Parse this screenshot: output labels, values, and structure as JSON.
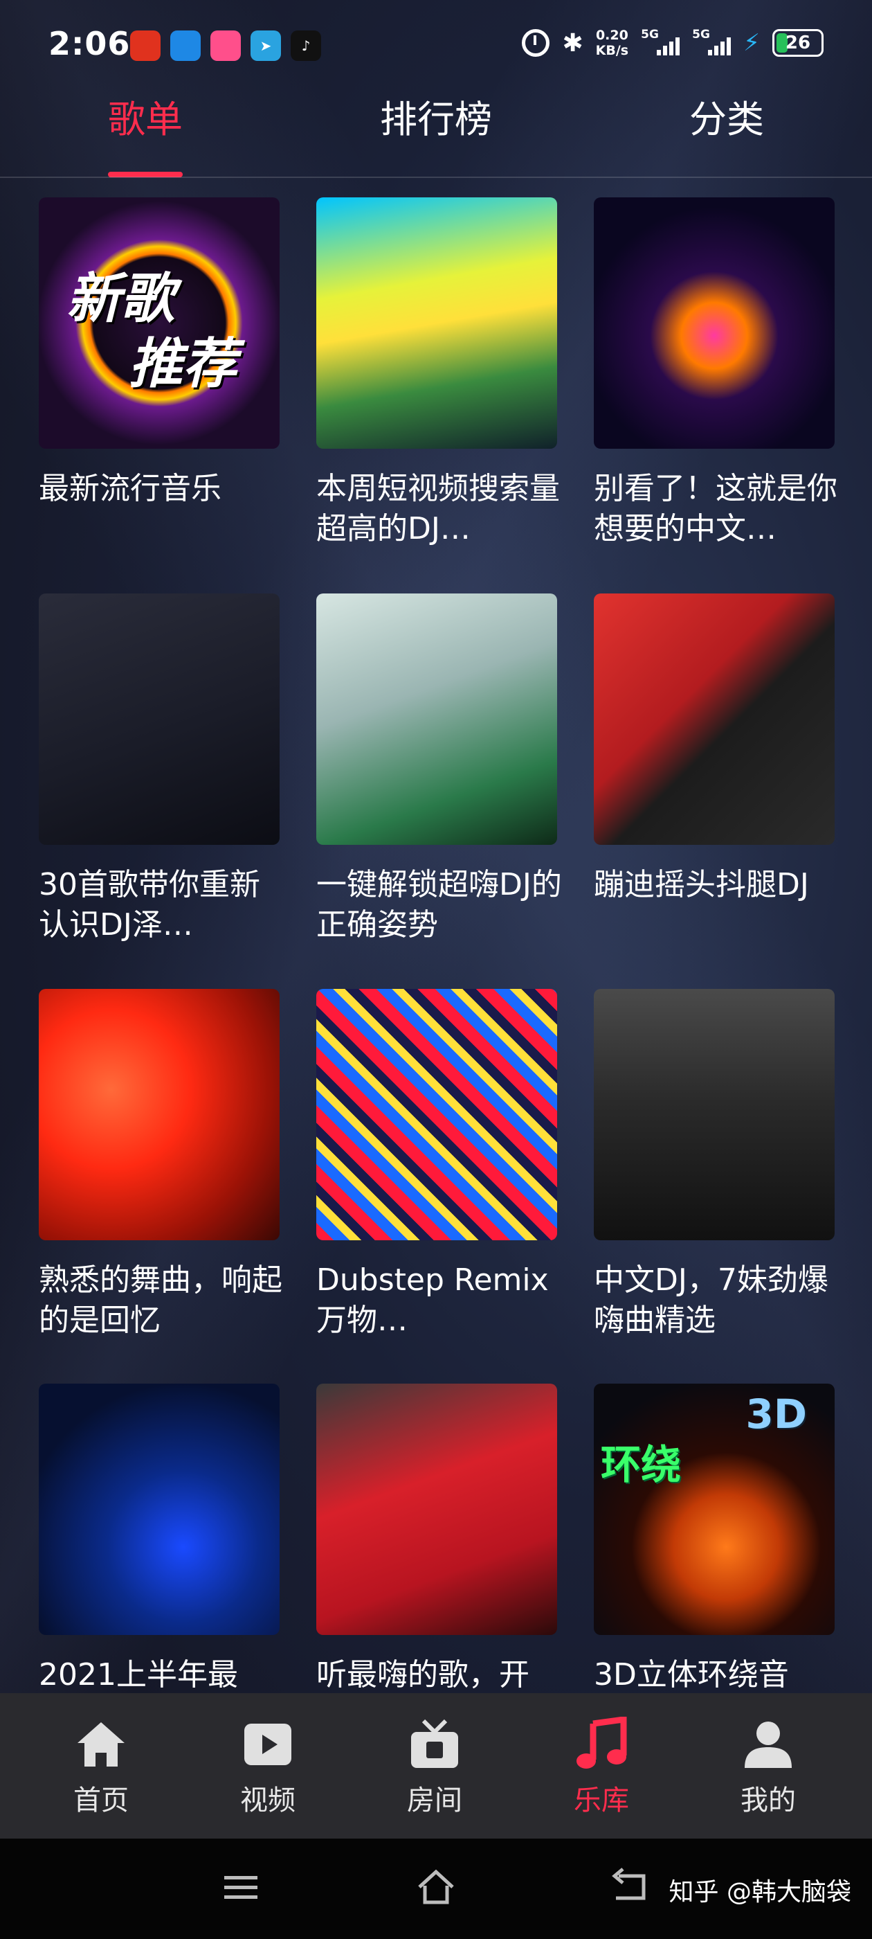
{
  "status_bar": {
    "time": "2:06",
    "net_speed_value": "0.20",
    "net_speed_unit": "KB/s",
    "signal_1": "5G",
    "signal_2": "5G",
    "battery": "26"
  },
  "tabs": [
    {
      "label": "歌单",
      "active": true
    },
    {
      "label": "排行榜",
      "active": false
    },
    {
      "label": "分类",
      "active": false
    }
  ],
  "playlists": [
    {
      "title": "最新流行音乐",
      "cover_text": [
        "新歌",
        "推荐"
      ]
    },
    {
      "title": "本周短视频搜索量超高的DJ…"
    },
    {
      "title": "别看了！这就是你想要的中文…"
    },
    {
      "title": "30首歌带你重新认识DJ泽…"
    },
    {
      "title": "一键解锁超嗨DJ的正确姿势"
    },
    {
      "title": "蹦迪摇头抖腿DJ"
    },
    {
      "title": "熟悉的舞曲，响起的是回忆"
    },
    {
      "title": "Dubstep Remix 万物…"
    },
    {
      "title": "中文DJ，7妹劲爆嗨曲精选"
    },
    {
      "title": "2021上半年最"
    },
    {
      "title": "听最嗨的歌，开"
    },
    {
      "title": "3D立体环绕音",
      "cover_text": [
        "3D",
        "环绕"
      ]
    }
  ],
  "bottom_nav": [
    {
      "label": "首页",
      "icon": "home-icon",
      "active": false
    },
    {
      "label": "视频",
      "icon": "video-icon",
      "active": false
    },
    {
      "label": "房间",
      "icon": "room-icon",
      "active": false
    },
    {
      "label": "乐库",
      "icon": "music-note-icon",
      "active": true
    },
    {
      "label": "我的",
      "icon": "user-icon",
      "active": false
    }
  ],
  "watermark": "知乎 @韩大脑袋",
  "colors": {
    "accent": "#ff2d4d",
    "nav_bg": "#2a2a2e"
  }
}
